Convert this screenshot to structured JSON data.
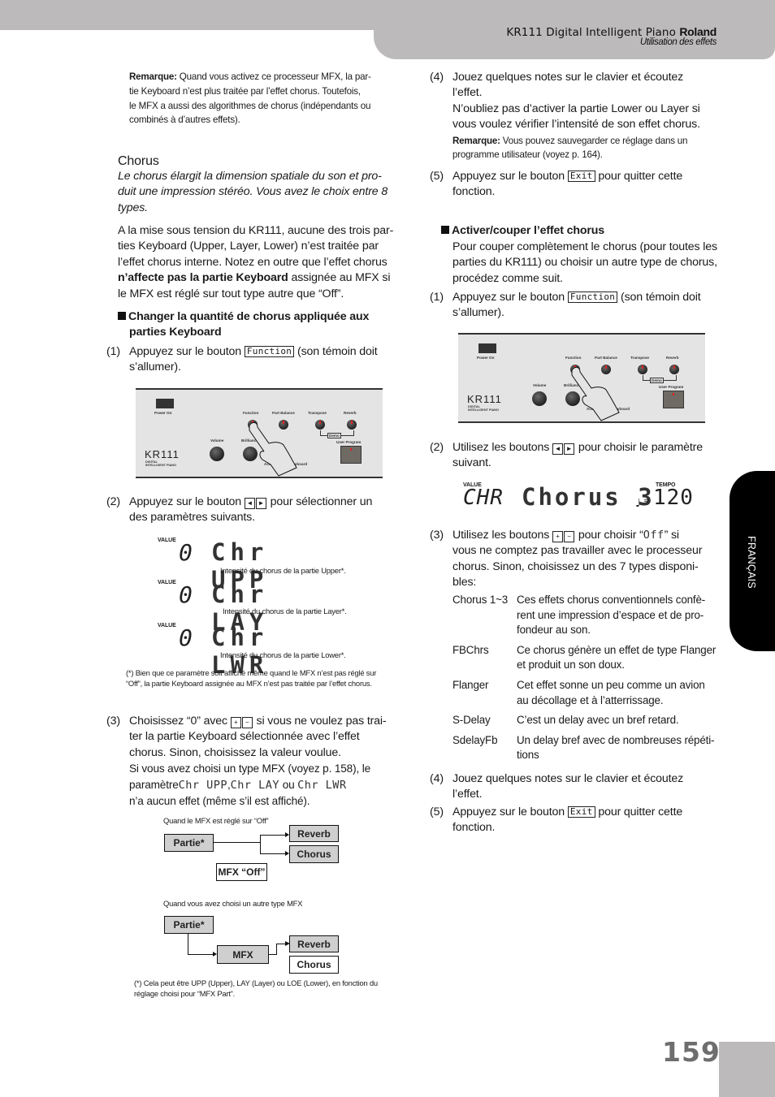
{
  "header": {
    "product": "KR111 Digital Intelligent Piano",
    "brand": "Roland",
    "section": "Utilisation des effets"
  },
  "side_tab": {
    "label": "FRANÇAIS"
  },
  "page_number": "159",
  "left": {
    "note1": {
      "label": "Remarque:",
      "lines": [
        "Quand vous activez ce processeur MFX, la par-",
        "tie Keyboard n’est plus traitée par l’effet chorus. Toutefois,",
        "le MFX a aussi des algorithmes de chorus (indépendants ou",
        "combinés à d’autres effets)."
      ]
    },
    "chorus_heading": "Chorus",
    "chorus_intro": [
      "Le chorus élargit la dimension spatiale du son et pro-",
      "duit une impression stéréo. Vous avez le choix entre 8",
      "types."
    ],
    "para": {
      "l1": "A la mise sous tension du KR111, aucune des trois par-",
      "l2": "ties Keyboard (Upper, Layer, Lower) n’est traitée par",
      "l3": "l’effet chorus interne. Notez en outre que l’effet chorus",
      "l4_bold": "n’affecte pas la partie Keyboard",
      "l4_rest": "  assignée au MFX si",
      "l5": "le MFX est réglé sur tout type autre que “Off”."
    },
    "subheading": [
      "Changer la quantité de chorus appliquée aux",
      "parties Keyboard"
    ],
    "step1": {
      "num": "(1)",
      "pre": "Appuyez sur le bouton",
      "key": "Function",
      "post": "(son témoin doit",
      "line2": "s’allumer)."
    },
    "panel": {
      "power_label": "Power   On",
      "buttons": [
        "Function",
        "Part Balance",
        "Transpose",
        "Reverb"
      ],
      "demo_label": "Demo",
      "knobs": [
        "Volume",
        "Brilliance",
        "Balance"
      ],
      "acc_label": "Accomp.",
      "kbd_label": "Keyboard",
      "user_program": "User Program",
      "logo": "KR111",
      "logo_sub1": "DIGITAL",
      "logo_sub2": "INTELLIGENT PIANO"
    },
    "step2": {
      "num": "(2)",
      "pre": "Appuyez sur le bouton",
      "post": "pour sélectionner un",
      "line2": "des paramètres suivants."
    },
    "lcd_rows": [
      {
        "label": "VALUE",
        "value": "0",
        "text": "Chr UPP",
        "caption": "Intensité du chorus de la partie Upper*."
      },
      {
        "label": "VALUE",
        "value": "0",
        "text": "Chr LAY",
        "caption": "Intensité du chorus de la partie Layer*."
      },
      {
        "label": "VALUE",
        "value": "0",
        "text": "Chr LWR",
        "caption": "Intensité du chorus de la partie Lower*."
      }
    ],
    "footnote1": [
      "(*) Bien que ce paramètre soit affiché même quand le MFX n’est pas réglé sur",
      "“Off”, la partie Keyboard assignée au MFX n’est pas traitée par l’effet chorus."
    ],
    "step3": {
      "num": "(3)",
      "l1_pre": "Choisissez “0” avec",
      "l1_post": "si vous ne voulez pas trai-",
      "l2": "ter la partie Keyboard sélectionnée avec l’effet",
      "l3": "chorus. Sinon, choisissez la valeur voulue.",
      "l4": "Si vous avez choisi un type MFX (voyez p. 158), le",
      "l5_pre": "paramètre",
      "l5_p1": "Chr UPP",
      "l5_p2": "Chr LAY",
      "l5_ou": "ou",
      "l5_p3": "Chr LWR",
      "l6": "n’a aucun effet (même s’il est affiché)."
    },
    "diagram": {
      "caption1": "Quand le MFX est réglé sur “Off”",
      "caption2": "Quand vous avez choisi un autre type MFX",
      "partie": "Partie*",
      "reverb": "Reverb",
      "chorus": "Chorus",
      "mfx_off": "MFX “Off”",
      "mfx": "MFX",
      "footnote": [
        "(*) Cela peut être UPP (Upper), LAY (Layer) ou LOE (Lower), en fonction du",
        "réglage choisi pour “MFX Part”."
      ]
    }
  },
  "right": {
    "step4": {
      "num": "(4)",
      "l1": "Jouez quelques notes sur le clavier et écoutez",
      "l2": "l’effet.",
      "l3": "N’oubliez pas d’activer la partie Lower ou Layer si",
      "l4": "vous voulez vérifier l’intensité de son effet chorus.",
      "note_label": "Remarque:",
      "note_l1": "Vous pouvez sauvegarder ce réglage dans un",
      "note_l2": "programme utilisateur (voyez p. 164)."
    },
    "step5": {
      "num": "(5)",
      "pre": "Appuyez sur le bouton",
      "key": "Exit",
      "post": "pour quitter cette",
      "line2": "fonction."
    },
    "subheading": "Activer/couper l’effet chorus",
    "sub_para": [
      "Pour couper complètement le chorus (pour toutes les",
      "parties du KR111) ou choisir un autre type de chorus,",
      "procédez comme suit."
    ],
    "step1": {
      "num": "(1)",
      "pre": "Appuyez sur le bouton",
      "key": "Function",
      "post": "(son témoin doit",
      "line2": "s’allumer)."
    },
    "step2": {
      "num": "(2)",
      "pre": "Utilisez les boutons",
      "post": "pour choisir le paramètre",
      "line2": "suivant."
    },
    "lcd": {
      "value_label": "VALUE",
      "value": "CHR",
      "text": "Chorus 3",
      "tempo_label": "TEMPO",
      "tempo": "120"
    },
    "step3": {
      "num": "(3)",
      "l1_pre": "Utilisez les boutons",
      "l1_mid": "pour choisir “",
      "l1_lcd": "Off",
      "l1_post": "” si",
      "l2": "vous ne comptez pas travailler avec le processeur",
      "l3": "chorus. Sinon, choisissez un des 7 types disponi-",
      "l4": "bles:"
    },
    "types": [
      {
        "name": "Chorus 1~3",
        "desc": [
          "Ces effets chorus conventionnels confè-",
          "rent une impression d’espace et de pro-",
          "fondeur au son."
        ]
      },
      {
        "name": "FBChrs",
        "desc": [
          "Ce chorus génère un effet de type Flanger",
          "et produit un son doux."
        ]
      },
      {
        "name": "Flanger",
        "desc": [
          "Cet effet sonne un peu comme un avion",
          "au décollage et à l’atterrissage."
        ]
      },
      {
        "name": "S-Delay",
        "desc": [
          "C’est un delay avec un bref retard."
        ]
      },
      {
        "name": "SdelayFb",
        "desc": [
          "Un delay bref avec de nombreuses répéti-",
          "tions"
        ]
      }
    ],
    "step4b": {
      "num": "(4)",
      "l1": "Jouez quelques notes sur le clavier et écoutez",
      "l2": "l’effet."
    },
    "step5b": {
      "num": "(5)",
      "pre": "Appuyez sur le bouton",
      "key": "Exit",
      "post": "pour quitter cette",
      "line2": "fonction."
    }
  },
  "keys": {
    "plus": "+",
    "minus": "−",
    "left": "◄",
    "right": "►"
  }
}
